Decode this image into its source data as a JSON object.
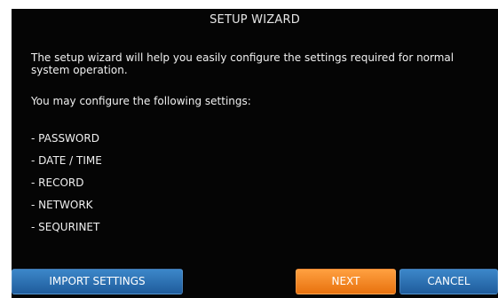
{
  "dialog": {
    "title": "SETUP WIZARD",
    "intro": "The setup wizard will help you easily configure the settings required for normal system operation.",
    "subhead": "You may configure the following settings:",
    "items": [
      {
        "label": "- PASSWORD"
      },
      {
        "label": "- DATE / TIME"
      },
      {
        "label": "- RECORD"
      },
      {
        "label": "- NETWORK"
      },
      {
        "label": "- SEQURINET"
      }
    ]
  },
  "buttons": {
    "import_label": "IMPORT SETTINGS",
    "next_label": "NEXT",
    "cancel_label": "CANCEL"
  },
  "colors": {
    "background": "#050505",
    "button_blue": "#2a6fb3",
    "button_orange": "#f7891f",
    "text": "#f0f0f0"
  }
}
